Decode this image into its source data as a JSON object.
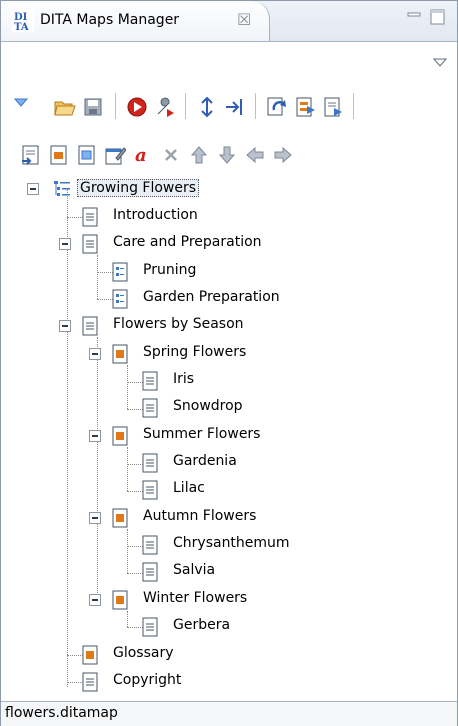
{
  "view": {
    "title": "DITA Maps Manager",
    "tab_icon_text_top": "DI",
    "tab_icon_text_bottom": "TA"
  },
  "colors": {
    "accent_blue": "#2f5fb0",
    "run_red": "#d0231c",
    "folder_orange": "#e07a18",
    "topic_blue": "#3a78c8"
  },
  "toolbar_row1": [
    {
      "name": "dropdown-menu-icon"
    },
    {
      "name": "open-folder-icon"
    },
    {
      "name": "save-icon"
    },
    {
      "name": "run-transformation-icon"
    },
    {
      "name": "configure-transformation-icon"
    },
    {
      "name": "validate-icon"
    },
    {
      "name": "check-references-icon"
    },
    {
      "name": "refresh-references-icon"
    },
    {
      "name": "open-map-in-editor-icon"
    },
    {
      "name": "export-map-icon"
    }
  ],
  "toolbar_row2": [
    {
      "name": "insert-reference-icon"
    },
    {
      "name": "insert-topic-heading-icon"
    },
    {
      "name": "insert-topic-group-icon"
    },
    {
      "name": "edit-properties-icon"
    },
    {
      "name": "edit-attributes-icon"
    },
    {
      "name": "delete-icon"
    },
    {
      "name": "move-up-icon"
    },
    {
      "name": "move-down-icon"
    },
    {
      "name": "promote-icon"
    },
    {
      "name": "demote-icon"
    }
  ],
  "tree": {
    "root": "Growing Flowers",
    "introduction": "Introduction",
    "care": "Care and Preparation",
    "pruning": "Pruning",
    "garden_prep": "Garden Preparation",
    "by_season": "Flowers by Season",
    "spring": "Spring Flowers",
    "iris": "Iris",
    "snowdrop": "Snowdrop",
    "summer": "Summer Flowers",
    "gardenia": "Gardenia",
    "lilac": "Lilac",
    "autumn": "Autumn Flowers",
    "chrysanthemum": "Chrysanthemum",
    "salvia": "Salvia",
    "winter": "Winter Flowers",
    "gerbera": "Gerbera",
    "glossary": "Glossary",
    "copyright": "Copyright"
  },
  "status": {
    "file": "flowers.ditamap"
  }
}
